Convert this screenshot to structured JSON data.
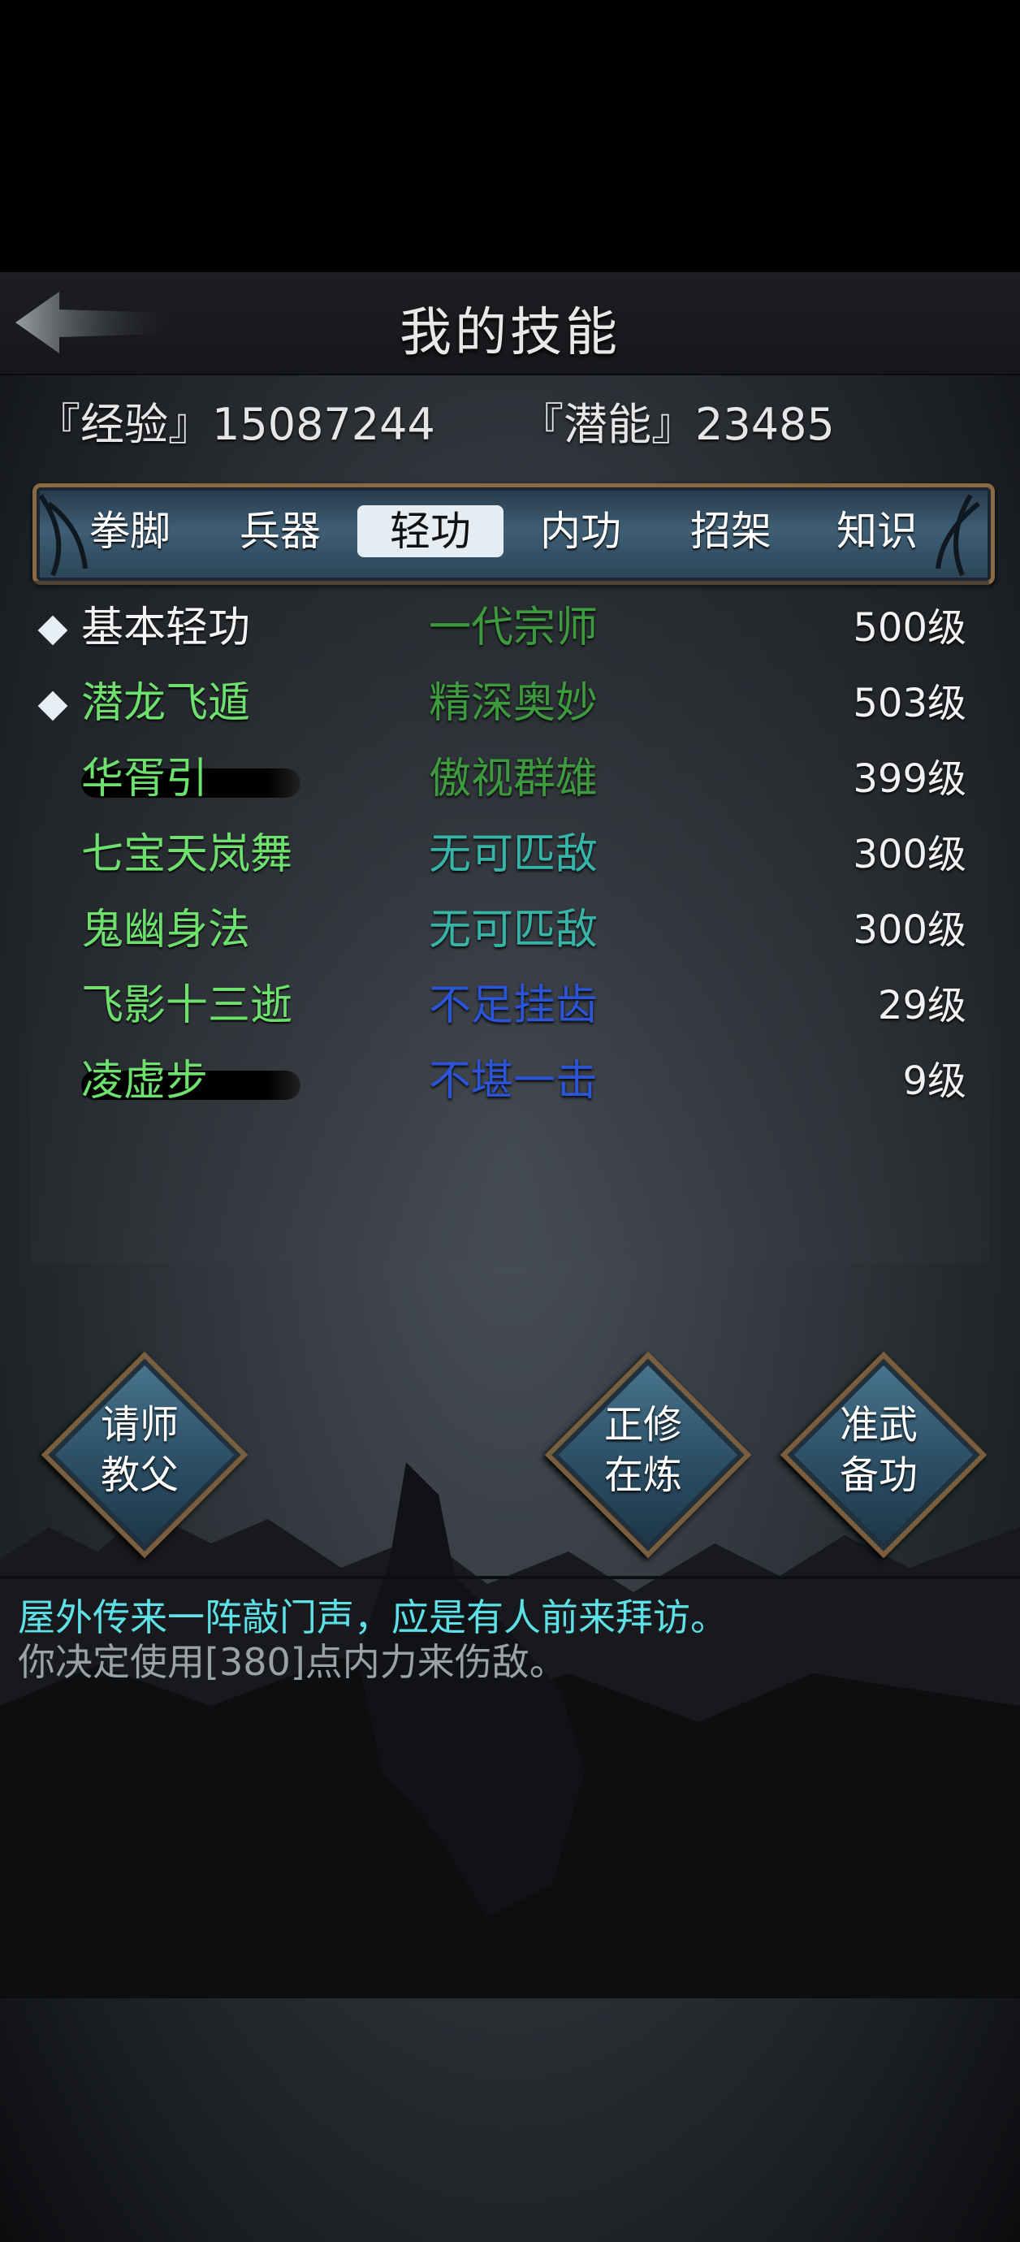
{
  "header": {
    "title": "我的技能",
    "back_icon": "back-arrow-icon"
  },
  "stats": {
    "experience": "『经验』15087244",
    "potential": "『潜能』23485"
  },
  "tabs": [
    {
      "label": "拳脚",
      "active": false
    },
    {
      "label": "兵器",
      "active": false
    },
    {
      "label": "轻功",
      "active": true
    },
    {
      "label": "内功",
      "active": false
    },
    {
      "label": "招架",
      "active": false
    },
    {
      "label": "知识",
      "active": false
    }
  ],
  "skills": [
    {
      "name": "基本轻功",
      "rank": "一代宗师",
      "level": "500级",
      "selected": true,
      "name_color": "#f4f4f4",
      "rank_color": "#3e9a3e"
    },
    {
      "name": "潜龙飞遁",
      "rank": "精深奥妙",
      "level": "503级",
      "selected": true,
      "name_color": "#6ee06e",
      "rank_color": "#3e9a3e"
    },
    {
      "name": "华胥引",
      "rank": "傲视群雄",
      "level": "399级",
      "selected": false,
      "name_color": "#6ee06e",
      "rank_color": "#3e9a3e"
    },
    {
      "name": "七宝天岚舞",
      "rank": "无可匹敌",
      "level": "300级",
      "selected": false,
      "name_color": "#6ee06e",
      "rank_color": "#37b4a8"
    },
    {
      "name": "鬼幽身法",
      "rank": "无可匹敌",
      "level": "300级",
      "selected": false,
      "name_color": "#6ee06e",
      "rank_color": "#37b4a8"
    },
    {
      "name": "飞影十三逝",
      "rank": "不足挂齿",
      "level": "29级",
      "selected": false,
      "name_color": "#6ee06e",
      "rank_color": "#2b54d6"
    },
    {
      "name": "凌虚步",
      "rank": "不堪一击",
      "level": "9级",
      "selected": false,
      "name_color": "#6ee06e",
      "rank_color": "#2b54d6"
    }
  ],
  "actions": {
    "teacher": {
      "line1": "请师",
      "line2": "教父"
    },
    "practice": {
      "line1": "正修",
      "line2": "在炼"
    },
    "prepare": {
      "line1": "准武",
      "line2": "备功"
    }
  },
  "messages": [
    "屋外传来一阵敲门声，应是有人前来拜访。",
    "你决定使用[380]点内力来伤敌。"
  ],
  "colors": {
    "message_highlight": "#5de0e6",
    "message_normal": "#9aa2a9",
    "frame_gold": "#8a6a42"
  }
}
